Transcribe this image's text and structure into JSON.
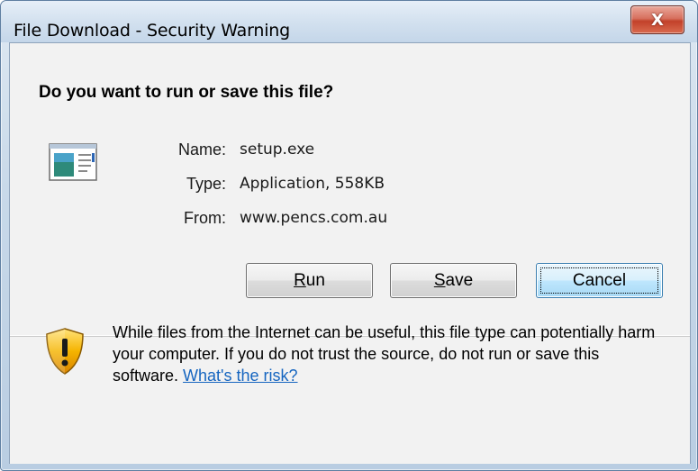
{
  "window": {
    "title": "File Download - Security Warning",
    "close_label": "X"
  },
  "dialog": {
    "question": "Do you want to run or save this file?",
    "file": {
      "name_label": "Name:",
      "name_value": "setup.exe",
      "type_label": "Type:",
      "type_value": "Application, 558KB",
      "from_label": "From:",
      "from_value": "www.pencs.com.au"
    },
    "buttons": {
      "run_accel": "R",
      "run_rest": "un",
      "save_accel": "S",
      "save_rest": "ave",
      "cancel": "Cancel"
    },
    "warning": {
      "text": "While files from the Internet can be useful, this file type can potentially harm your computer. If you do not trust the source, do not run or save this software.",
      "link": "What's the risk?"
    }
  },
  "icons": {
    "file": "application-file-icon",
    "warning": "security-shield-icon"
  },
  "colors": {
    "link": "#1565c0",
    "default_button": "#a7d9f5",
    "close_button": "#c2412a"
  }
}
